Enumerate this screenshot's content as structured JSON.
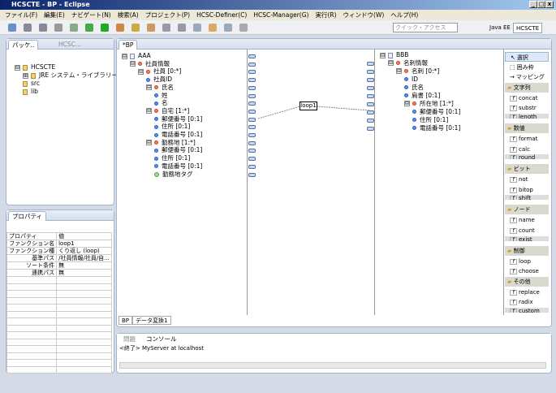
{
  "window": {
    "title": "HCSCTE - BP - Eclipse",
    "min": "_",
    "max": "□",
    "close": "x"
  },
  "menu": [
    "ファイル(F)",
    "編集(E)",
    "ナビゲート(N)",
    "検索(A)",
    "プロジェクト(P)",
    "HCSC-Definer(C)",
    "HCSC-Manager(G)",
    "実行(R)",
    "ウィンドウ(W)",
    "ヘルプ(H)"
  ],
  "toolbar": {
    "quick_access_placeholder": "クイック・アクセス",
    "perspectives": [
      "Java EE",
      "HCSCTE"
    ]
  },
  "explorer": {
    "tabs": [
      "パッケ..",
      "HCSC..."
    ],
    "tree": [
      {
        "label": "HCSCTE",
        "level": 0,
        "exp": "⊟"
      },
      {
        "label": "JRE システム・ライブラリー",
        "suffix": "[jdk]",
        "level": 1,
        "exp": "⊞"
      },
      {
        "label": "src",
        "level": 1
      },
      {
        "label": "lib",
        "level": 1
      }
    ]
  },
  "properties": {
    "tab": "プロパティ",
    "columns": [
      "プロパティ",
      "値"
    ],
    "rows": [
      [
        "ファンクション名",
        "loop1"
      ],
      [
        "ファンクション種",
        "くり返し (loop)"
      ],
      [
        "基準パス",
        "/社員情報/社員/自..."
      ],
      [
        "ソート条件",
        "無"
      ],
      [
        "連携パス",
        "無"
      ]
    ]
  },
  "editor": {
    "tab": "*BP",
    "bottom_tabs": [
      "BP",
      "データ変換1"
    ],
    "source": [
      {
        "label": "AAA",
        "level": 0,
        "type": "d",
        "exp": "⊟"
      },
      {
        "label": "社員情報",
        "level": 1,
        "type": "c",
        "exp": "⊟"
      },
      {
        "label": "社員 [0:*]",
        "level": 2,
        "type": "c",
        "exp": "⊟"
      },
      {
        "label": "社員ID",
        "level": 3,
        "type": "l"
      },
      {
        "label": "氏名",
        "level": 3,
        "type": "c",
        "exp": "⊟"
      },
      {
        "label": "姓",
        "level": 4,
        "type": "l"
      },
      {
        "label": "名",
        "level": 4,
        "type": "l"
      },
      {
        "label": "自宅 [1:*]",
        "level": 3,
        "type": "c",
        "exp": "⊟"
      },
      {
        "label": "郵便番号 [0:1]",
        "level": 4,
        "type": "l"
      },
      {
        "label": "住所 [0:1]",
        "level": 4,
        "type": "l"
      },
      {
        "label": "電話番号 [0:1]",
        "level": 4,
        "type": "l"
      },
      {
        "label": "勤務地 [1:*]",
        "level": 3,
        "type": "c",
        "exp": "⊟"
      },
      {
        "label": "郵便番号 [0:1]",
        "level": 4,
        "type": "l"
      },
      {
        "label": "住所 [0:1]",
        "level": 4,
        "type": "l"
      },
      {
        "label": "電話番号 [0:1]",
        "level": 4,
        "type": "l"
      },
      {
        "label": "勤務地タグ",
        "level": 4,
        "type": "a"
      }
    ],
    "target": [
      {
        "label": "BBB",
        "level": 0,
        "type": "d",
        "exp": "⊟"
      },
      {
        "label": "名刺情報",
        "level": 1,
        "type": "c",
        "exp": "⊟"
      },
      {
        "label": "名刺 [0:*]",
        "level": 2,
        "type": "c",
        "exp": "⊟"
      },
      {
        "label": "ID",
        "level": 3,
        "type": "l"
      },
      {
        "label": "氏名",
        "level": 3,
        "type": "l"
      },
      {
        "label": "肩書 [0:1]",
        "level": 3,
        "type": "l"
      },
      {
        "label": "所在地 [1:*]",
        "level": 3,
        "type": "c",
        "exp": "⊟"
      },
      {
        "label": "郵便番号 [0:1]",
        "level": 4,
        "type": "l"
      },
      {
        "label": "住所 [0:1]",
        "level": 4,
        "type": "l"
      },
      {
        "label": "電話番号 [0:1]",
        "level": 4,
        "type": "l"
      }
    ],
    "function_node": "loop1"
  },
  "palette": [
    {
      "label": "選択",
      "kind": "tool"
    },
    {
      "label": "囲み枠",
      "kind": "tool"
    },
    {
      "label": "マッピング",
      "kind": "tool"
    },
    {
      "label": "文字列",
      "kind": "header"
    },
    {
      "label": "concat"
    },
    {
      "label": "substr"
    },
    {
      "label": "length",
      "cut": true
    },
    {
      "label": "数値",
      "kind": "header"
    },
    {
      "label": "format"
    },
    {
      "label": "calc"
    },
    {
      "label": "round",
      "cut": true
    },
    {
      "label": "ビット",
      "kind": "header"
    },
    {
      "label": "not"
    },
    {
      "label": "bitop"
    },
    {
      "label": "shift",
      "cut": true
    },
    {
      "label": "ノード",
      "kind": "header"
    },
    {
      "label": "name"
    },
    {
      "label": "count"
    },
    {
      "label": "exist",
      "cut": true
    },
    {
      "label": "制御",
      "kind": "header"
    },
    {
      "label": "loop"
    },
    {
      "label": "choose"
    },
    {
      "label": "その他",
      "kind": "header"
    },
    {
      "label": "replace"
    },
    {
      "label": "radix"
    },
    {
      "label": "custom",
      "cut": true
    }
  ],
  "console": {
    "tabs": [
      "問題",
      "コンソール"
    ],
    "text": "<終了> MyServer at localhost"
  }
}
